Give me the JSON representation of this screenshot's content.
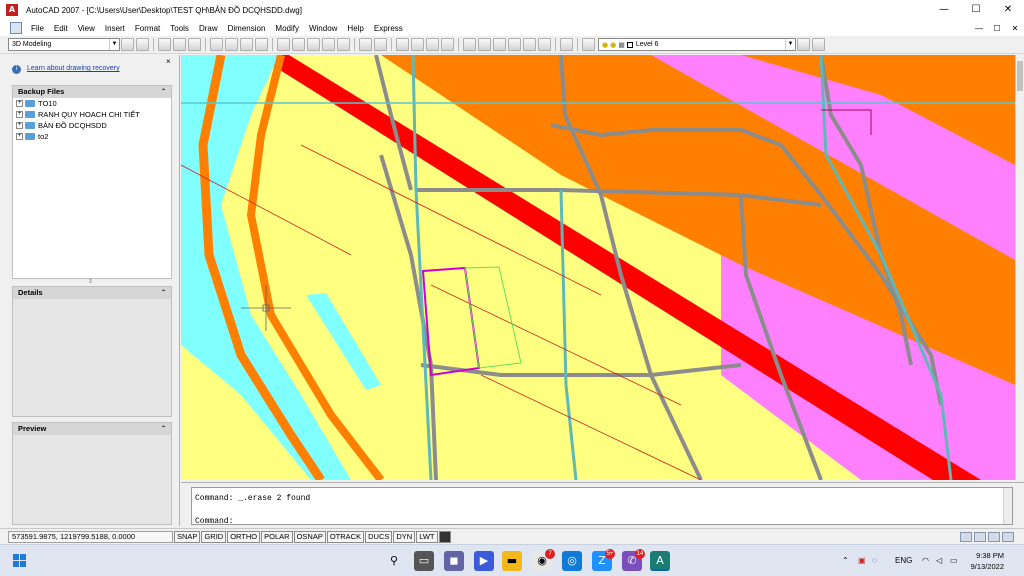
{
  "window": {
    "app_logo": "A",
    "title": "AutoCAD 2007 - [C:\\Users\\User\\Desktop\\TEST QH\\BẢN ĐỒ DCQHSDD.dwg]",
    "min_glyph": "—",
    "max_glyph": "☐",
    "close_glyph": "✕"
  },
  "menu": [
    "File",
    "Edit",
    "View",
    "Insert",
    "Format",
    "Tools",
    "Draw",
    "Dimension",
    "Modify",
    "Window",
    "Help",
    "Express"
  ],
  "toolbar": {
    "workspace": "3D Modeling",
    "layer": "Level 6"
  },
  "left_panel": {
    "close_glyph": "×",
    "recovery_link": "Learn about drawing recovery",
    "backup_title": "Backup Files",
    "backup_items": [
      "TO10",
      "RANH QUY HOACH CHI TIẾT",
      "BẢN ĐỒ DCQHSDD",
      "to2"
    ],
    "details_title": "Details",
    "preview_title": "Preview"
  },
  "command": {
    "line1": "Command: _.erase 2 found",
    "line2": "Command:"
  },
  "status": {
    "coords": "573591.9875, 1219799.5188, 0.0000",
    "buttons": [
      "SNAP",
      "GRID",
      "ORTHO",
      "POLAR",
      "OSNAP",
      "OTRACK",
      "DUCS",
      "DYN",
      "LWT"
    ]
  },
  "taskbar": {
    "lang": "ENG",
    "time": "9:38 PM",
    "date": "9/13/2022",
    "badge_chrome": "7",
    "badge_app1": "5+",
    "badge_app2": "14"
  },
  "colors": {
    "land_yellow": "#ffff80",
    "zone_orange": "#ff8000",
    "zone_magenta": "#ff80ff",
    "road_red": "#ff0000",
    "water_cyan": "#80ffff",
    "road_grey": "#8c8c8c",
    "road_teal": "#5fb8b8"
  }
}
